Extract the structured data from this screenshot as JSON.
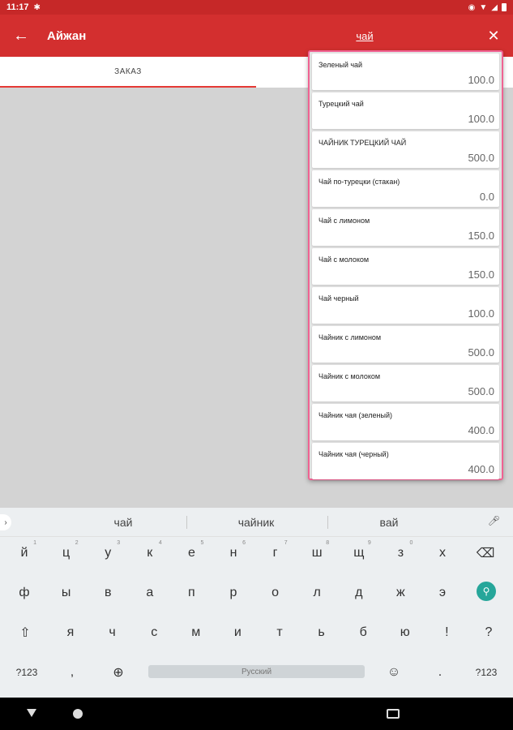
{
  "status_bar": {
    "time": "11:17"
  },
  "app_bar": {
    "title": "Айжан",
    "search_value": "чай"
  },
  "tabs": [
    {
      "label": "ЗАКАЗ"
    }
  ],
  "dropdown": {
    "items": [
      {
        "name": "Зеленый чай",
        "price": "100.0"
      },
      {
        "name": "Турецкий чай",
        "price": "100.0"
      },
      {
        "name": "ЧАЙНИК ТУРЕЦКИЙ ЧАЙ",
        "price": "500.0"
      },
      {
        "name": "Чай по-турецки (стакан)",
        "price": "0.0"
      },
      {
        "name": "Чай с лимоном",
        "price": "150.0"
      },
      {
        "name": "Чай с молоком",
        "price": "150.0"
      },
      {
        "name": "Чай черный",
        "price": "100.0"
      },
      {
        "name": "Чайник с лимоном",
        "price": "500.0"
      },
      {
        "name": "Чайник с молоком",
        "price": "500.0"
      },
      {
        "name": "Чайник чая (зеленый)",
        "price": "400.0"
      },
      {
        "name": "Чайник чая (черный)",
        "price": "400.0"
      }
    ]
  },
  "keyboard": {
    "suggestions": [
      "чай",
      "чайник",
      "вай"
    ],
    "row1": [
      {
        "k": "й",
        "n": "1"
      },
      {
        "k": "ц",
        "n": "2"
      },
      {
        "k": "у",
        "n": "3"
      },
      {
        "k": "к",
        "n": "4"
      },
      {
        "k": "е",
        "n": "5"
      },
      {
        "k": "н",
        "n": "6"
      },
      {
        "k": "г",
        "n": "7"
      },
      {
        "k": "ш",
        "n": "8"
      },
      {
        "k": "щ",
        "n": "9"
      },
      {
        "k": "з",
        "n": "0"
      },
      {
        "k": "х",
        "n": ""
      }
    ],
    "row2": [
      "ф",
      "ы",
      "в",
      "а",
      "п",
      "р",
      "о",
      "л",
      "д",
      "ж",
      "э"
    ],
    "row3": [
      "я",
      "ч",
      "с",
      "м",
      "и",
      "т",
      "ь",
      "б",
      "ю",
      "!",
      "?"
    ],
    "symbols_label": "?123",
    "comma": ",",
    "period": ".",
    "space_label": "Русский"
  },
  "icons": {
    "back": "arrow-left-icon",
    "close": "close-icon",
    "backspace": "backspace-icon",
    "search": "search-icon",
    "shift": "shift-icon",
    "globe": "globe-icon",
    "emoji": "emoji-icon",
    "mic": "mic-icon"
  },
  "colors": {
    "app_bar": "#d32f2f",
    "accent": "#f06292",
    "search_key": "#26a69a"
  }
}
